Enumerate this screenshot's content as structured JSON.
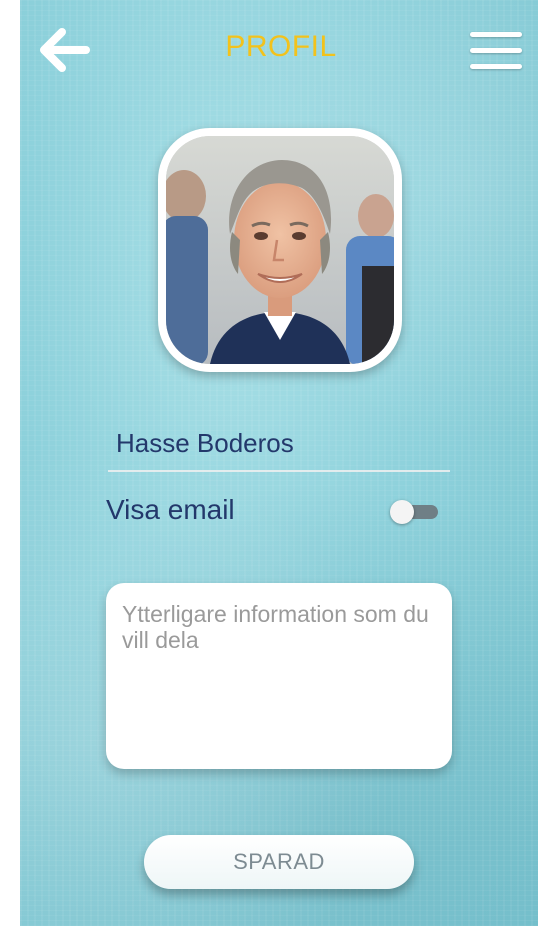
{
  "header": {
    "title": "PROFIL",
    "back_icon": "arrow-left-icon",
    "menu_icon": "hamburger-menu-icon",
    "title_color": "#f2c21c"
  },
  "profile": {
    "avatar_icon": "profile-photo",
    "name": "Hasse Boderos"
  },
  "settings": {
    "show_email_label": "Visa email",
    "show_email_enabled": false
  },
  "info": {
    "value": "",
    "placeholder": "Ytterligare information som du vill dela"
  },
  "actions": {
    "save_label": "SPARAD"
  }
}
